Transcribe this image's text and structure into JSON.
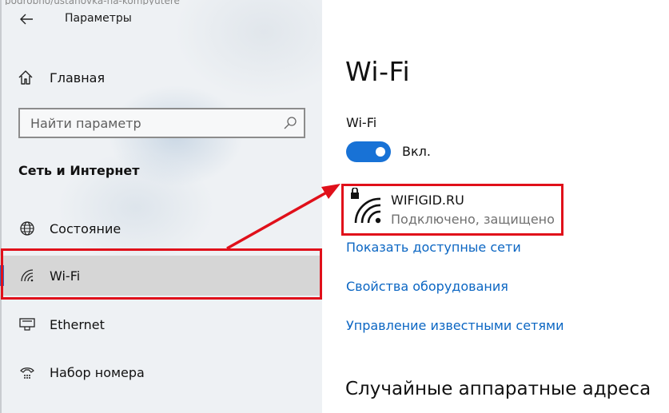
{
  "window": {
    "title": "Параметры",
    "top_strip_text": "podrobno/ustanovka-na-kompyutere"
  },
  "sidebar": {
    "home_label": "Главная",
    "search_placeholder": "Найти параметр",
    "section_title": "Сеть и Интернет",
    "items": [
      {
        "label": "Состояние",
        "icon": "globe-icon",
        "selected": false
      },
      {
        "label": "Wi-Fi",
        "icon": "wifi-icon",
        "selected": true
      },
      {
        "label": "Ethernet",
        "icon": "ethernet-icon",
        "selected": false
      },
      {
        "label": "Набор номера",
        "icon": "dialup-icon",
        "selected": false
      }
    ]
  },
  "main": {
    "title": "Wi-Fi",
    "wifi_label": "Wi-Fi",
    "toggle_state": "Вкл.",
    "toggle_on": true,
    "network": {
      "ssid": "WIFIGID.RU",
      "status": "Подключено, защищено",
      "secured": true
    },
    "links": [
      "Показать доступные сети",
      "Свойства оборудования",
      "Управление известными сетями"
    ],
    "section_heading": "Случайные аппаратные адреса"
  },
  "colors": {
    "accent": "#1872d6",
    "link": "#0b66c3",
    "highlight": "#e0101a",
    "selected_bg": "#d6d6d6"
  }
}
